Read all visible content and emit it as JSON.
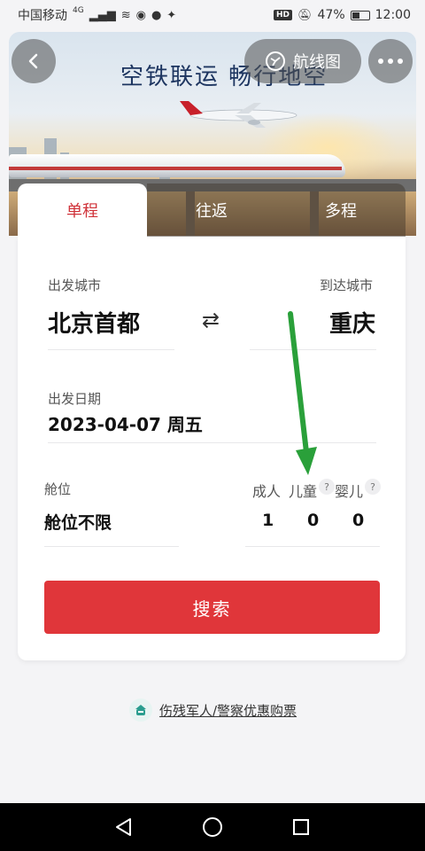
{
  "status_bar": {
    "carrier": "中国移动",
    "network": "4G",
    "battery": "47%",
    "time": "12:00",
    "hd": "HD"
  },
  "banner": {
    "slogan": "空铁联运  畅行地空"
  },
  "header": {
    "route_map_label": "航线图"
  },
  "tabs": [
    {
      "label": "单程",
      "active": true
    },
    {
      "label": "往返",
      "active": false
    },
    {
      "label": "多程",
      "active": false
    }
  ],
  "form": {
    "departure_label": "出发城市",
    "departure_city": "北京首都",
    "arrival_label": "到达城市",
    "arrival_city": "重庆",
    "swap_icon": "⇄",
    "date_label": "出发日期",
    "date_value": "2023-04-07 周五",
    "class_label": "舱位",
    "class_value": "舱位不限",
    "passengers": [
      {
        "label": "成人",
        "count": "1",
        "help": ""
      },
      {
        "label": "儿童",
        "count": "0",
        "help": "?"
      },
      {
        "label": "婴儿",
        "count": "0",
        "help": "?"
      }
    ],
    "search_label": "搜索"
  },
  "discount": {
    "label": "伤残军人/警察优惠购票"
  },
  "colors": {
    "accent": "#e0363a",
    "active_tab_text": "#d0333a",
    "annotation": "#2aa03a"
  }
}
